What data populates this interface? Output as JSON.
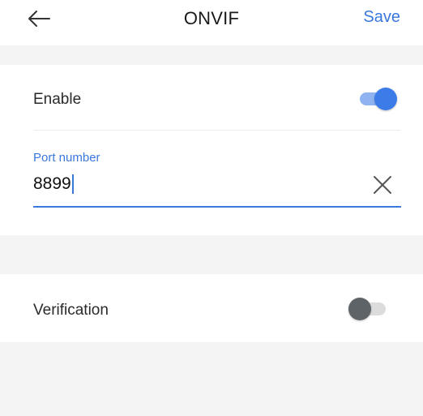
{
  "header": {
    "title": "ONVIF",
    "save_label": "Save",
    "back_icon": "arrow-left-icon"
  },
  "enable": {
    "label": "Enable",
    "on": true
  },
  "port": {
    "label": "Port number",
    "value": "8899",
    "clear_icon": "close-icon"
  },
  "verification": {
    "label": "Verification",
    "on": false
  },
  "colors": {
    "accent": "#3a78dd",
    "toggle_on_knob": "#3b7ce8",
    "toggle_on_track": "#8fb3f1",
    "toggle_off_knob": "#5e6368",
    "toggle_off_track": "#dcdcdc",
    "section_band": "#f4f4f5"
  }
}
